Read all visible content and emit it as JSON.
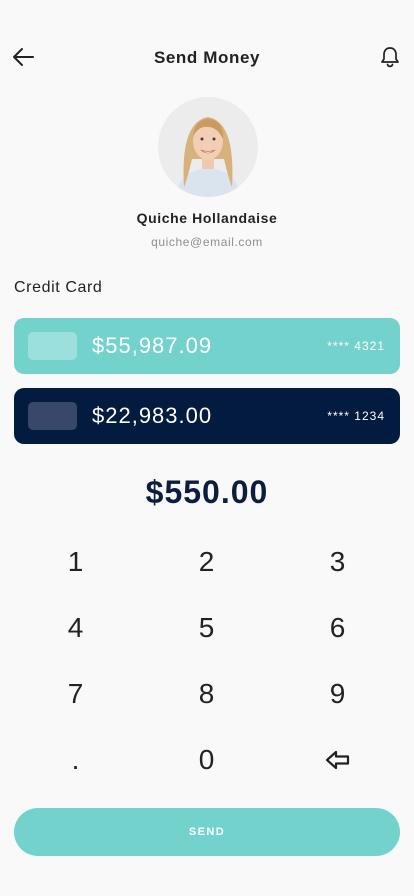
{
  "header": {
    "title": "Send Money",
    "back_icon": "arrow-left-icon",
    "bell_icon": "bell-icon"
  },
  "recipient": {
    "name": "Quiche Hollandaise",
    "email": "quiche@email.com"
  },
  "credit_card_label": "Credit Card",
  "cards": [
    {
      "balance": "$55,987.09",
      "number": "**** 4321",
      "color": "#74d2cd"
    },
    {
      "balance": "$22,983.00",
      "number": "**** 1234",
      "color": "#021b3f"
    }
  ],
  "amount": "$550.00",
  "keypad": {
    "k1": "1",
    "k2": "2",
    "k3": "3",
    "k4": "4",
    "k5": "5",
    "k6": "6",
    "k7": "7",
    "k8": "8",
    "k9": "9",
    "dot": ".",
    "k0": "0",
    "backspace_icon": "backspace-arrow-icon"
  },
  "send_button": "SEND",
  "colors": {
    "accent": "#74d2cd",
    "navy": "#021b3f",
    "background": "#f9f9f9"
  }
}
